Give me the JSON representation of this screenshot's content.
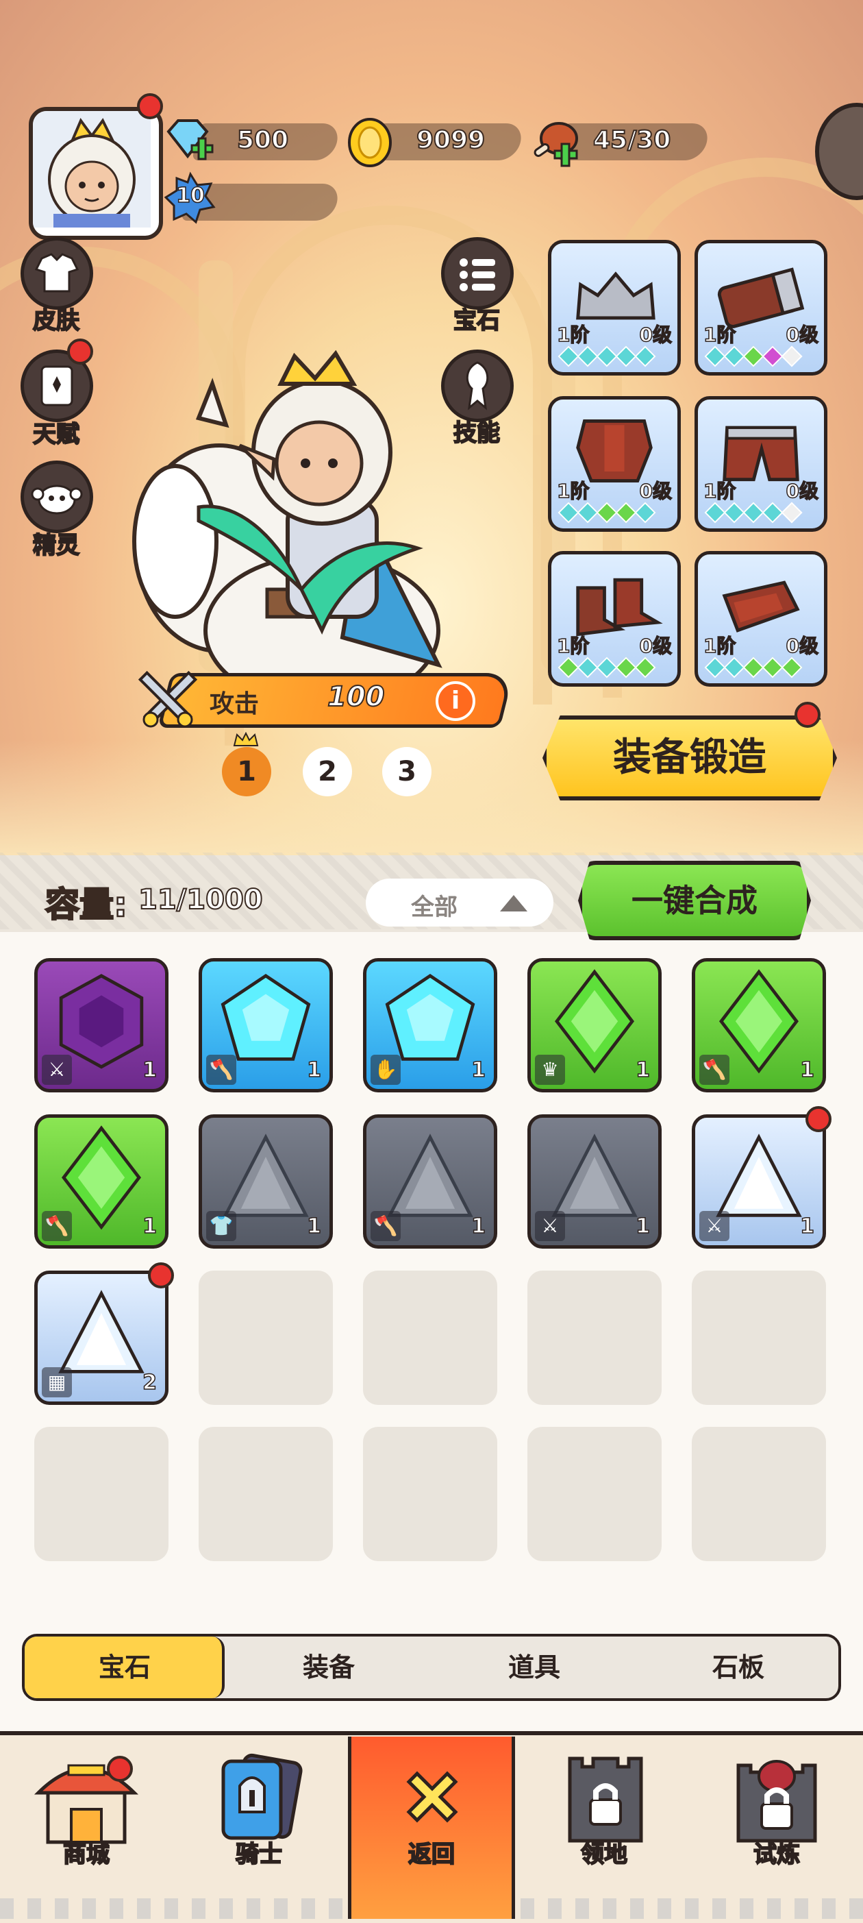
{
  "resources": {
    "gems": "500",
    "gold": "9099",
    "stamina": "45/30",
    "level": "10"
  },
  "side_left": [
    {
      "label": "皮肤"
    },
    {
      "label": "天赋"
    },
    {
      "label": "精灵"
    }
  ],
  "side_right": [
    {
      "label": "宝石"
    },
    {
      "label": "技能"
    }
  ],
  "equipment": [
    {
      "tier": "1阶",
      "level": "0级",
      "dots": [
        "#5cd6d6",
        "#5cd6d6",
        "#5cd6d6",
        "#5cd6d6",
        "#5cd6d6"
      ]
    },
    {
      "tier": "1阶",
      "level": "0级",
      "dots": [
        "#5cd6d6",
        "#5cd6d6",
        "#6ad64a",
        "#d14fd1",
        "#f0f0f0"
      ]
    },
    {
      "tier": "1阶",
      "level": "0级",
      "dots": [
        "#5cd6d6",
        "#5cd6d6",
        "#6ad64a",
        "#6ad64a",
        "#5cd6d6"
      ]
    },
    {
      "tier": "1阶",
      "level": "0级",
      "dots": [
        "#5cd6d6",
        "#5cd6d6",
        "#5cd6d6",
        "#5cd6d6",
        "#f0f0f0"
      ]
    },
    {
      "tier": "1阶",
      "level": "0级",
      "dots": [
        "#6ad64a",
        "#5cd6d6",
        "#5cd6d6",
        "#6ad64a",
        "#6ad64a"
      ]
    },
    {
      "tier": "1阶",
      "level": "0级",
      "dots": [
        "#5cd6d6",
        "#5cd6d6",
        "#6ad64a",
        "#6ad64a",
        "#6ad64a"
      ]
    }
  ],
  "attack": {
    "label": "攻击",
    "value": "100"
  },
  "pages": [
    "1",
    "2",
    "3"
  ],
  "forge_button": "装备锻造",
  "bag": {
    "capacity_label": "容量:",
    "capacity_value": "11/1000",
    "filter": "全部",
    "merge_button": "一键合成"
  },
  "bag_items": [
    {
      "color": "purple",
      "icon": "sword",
      "count": "1"
    },
    {
      "color": "cyan",
      "icon": "axe",
      "count": "1"
    },
    {
      "color": "cyan",
      "icon": "glove",
      "count": "1"
    },
    {
      "color": "green",
      "icon": "crown",
      "count": "1"
    },
    {
      "color": "green",
      "icon": "axe",
      "count": "1"
    },
    {
      "color": "green",
      "icon": "axe",
      "count": "1"
    },
    {
      "color": "gray",
      "icon": "shirt",
      "count": "1"
    },
    {
      "color": "gray",
      "icon": "axe",
      "count": "1"
    },
    {
      "color": "gray",
      "icon": "sword",
      "count": "1"
    },
    {
      "color": "white",
      "icon": "sword",
      "count": "1"
    },
    {
      "color": "white",
      "icon": "pants",
      "count": "2"
    }
  ],
  "tabs": [
    "宝石",
    "装备",
    "道具",
    "石板"
  ],
  "nav": [
    "商城",
    "骑士",
    "返回",
    "领地",
    "试炼"
  ],
  "colors": {
    "accent_yellow": "#ffd24a",
    "merge_green": "#6fd03a",
    "return_orange": "#ff7a3d",
    "red_dot": "#e8332f"
  }
}
